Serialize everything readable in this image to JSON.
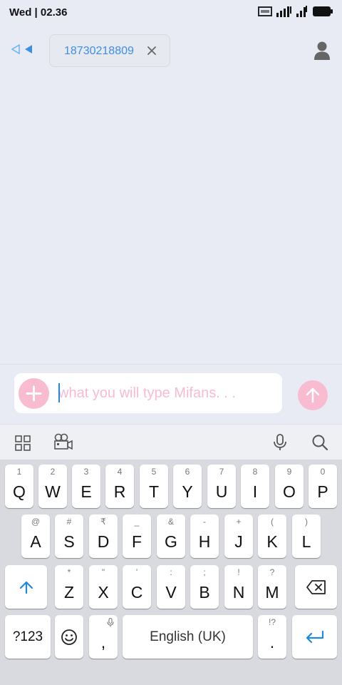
{
  "status": {
    "time": "Wed | 02.36"
  },
  "header": {
    "recipient_number": "18730218809"
  },
  "compose": {
    "placeholder": "what you will type Mifans. . ."
  },
  "keyboard": {
    "row1": [
      {
        "hint": "1",
        "label": "Q"
      },
      {
        "hint": "2",
        "label": "W"
      },
      {
        "hint": "3",
        "label": "E"
      },
      {
        "hint": "4",
        "label": "R"
      },
      {
        "hint": "5",
        "label": "T"
      },
      {
        "hint": "6",
        "label": "Y"
      },
      {
        "hint": "7",
        "label": "U"
      },
      {
        "hint": "8",
        "label": "I"
      },
      {
        "hint": "9",
        "label": "O"
      },
      {
        "hint": "0",
        "label": "P"
      }
    ],
    "row2": [
      {
        "hint": "@",
        "label": "A"
      },
      {
        "hint": "#",
        "label": "S"
      },
      {
        "hint": "₹",
        "label": "D"
      },
      {
        "hint": "_",
        "label": "F"
      },
      {
        "hint": "&",
        "label": "G"
      },
      {
        "hint": "-",
        "label": "H"
      },
      {
        "hint": "+",
        "label": "J"
      },
      {
        "hint": "(",
        "label": "K"
      },
      {
        "hint": ")",
        "label": "L"
      }
    ],
    "row3": [
      {
        "hint": "*",
        "label": "Z"
      },
      {
        "hint": "\"",
        "label": "X"
      },
      {
        "hint": "'",
        "label": "C"
      },
      {
        "hint": ":",
        "label": "V"
      },
      {
        "hint": ";",
        "label": "B"
      },
      {
        "hint": "!",
        "label": "N"
      },
      {
        "hint": "?",
        "label": "M"
      }
    ],
    "symbols_label": "?123",
    "comma_label": ",",
    "space_label": "English (UK)",
    "period_hint": "!?",
    "period_label": "."
  },
  "colors": {
    "accent_pink": "#f8bbd0",
    "link_blue": "#3d8fe6",
    "keyboard_blue": "#1e88e5"
  }
}
